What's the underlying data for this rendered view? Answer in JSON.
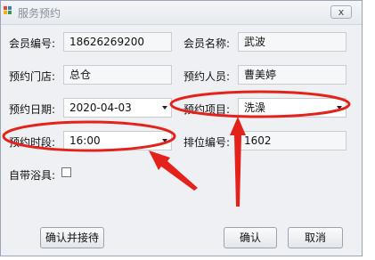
{
  "window": {
    "title": "服务预约",
    "close_label": "x"
  },
  "form": {
    "member_no_label": "会员编号:",
    "member_no": "18626269200",
    "member_name_label": "会员名称:",
    "member_name": "武波",
    "store_label": "预约门店:",
    "store": "总仓",
    "person_label": "预约人员:",
    "person": "曹美婷",
    "date_label": "预约日期:",
    "date": "2020-04-03",
    "item_label": "预约项目:",
    "item": "洗澡",
    "time_label": "预约时段:",
    "time": "16:00",
    "queue_label": "排位编号:",
    "queue_no": "1602",
    "bath_tool_label": "自带浴具:"
  },
  "buttons": {
    "confirm_and_receive": "确认并接待",
    "confirm": "确认",
    "cancel": "取消"
  },
  "colors": {
    "annotation": "#e3231b"
  },
  "icons": {
    "app": "app-logo-icon",
    "close": "close-icon",
    "dropdown": "chevron-down-icon",
    "annotation": "arrow-icon"
  }
}
